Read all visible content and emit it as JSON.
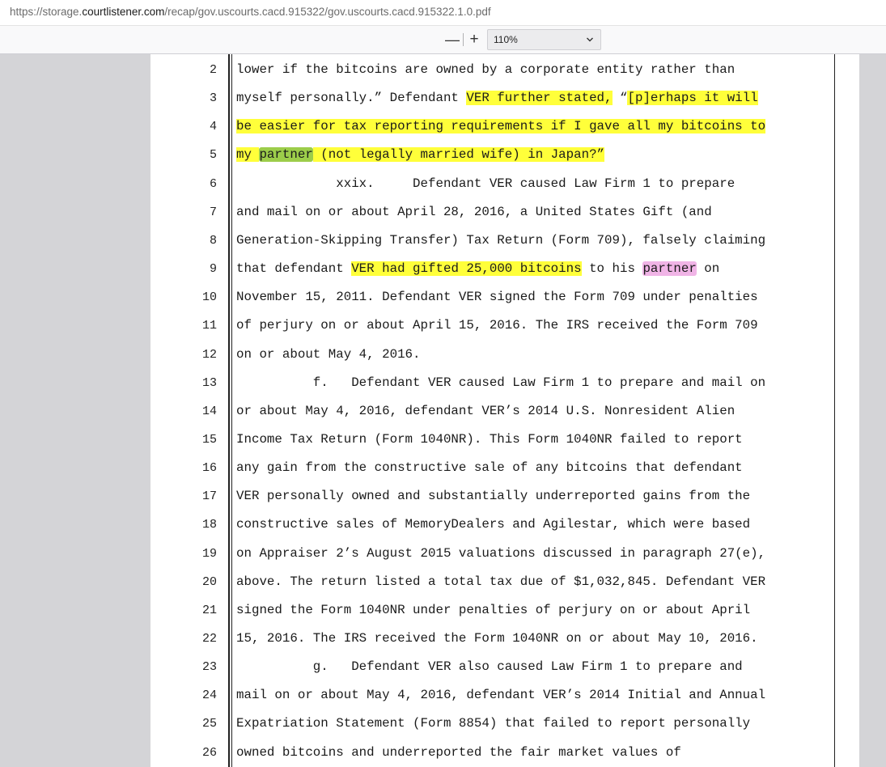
{
  "browser": {
    "url_prefix": "https://storage.",
    "url_domain": "courtlistener.com",
    "url_path": "/recap/gov.uscourts.cacd.915322/gov.uscourts.cacd.915322.1.0.pdf"
  },
  "toolbar": {
    "zoom_out_label": "—",
    "zoom_in_label": "+",
    "zoom_value": "110%"
  },
  "colors": {
    "highlight_yellow": "#ffff3a",
    "highlight_green": "#9ccd4a",
    "highlight_pink": "#f0b4e6"
  },
  "document": {
    "lines": [
      {
        "n": "2",
        "segments": [
          {
            "t": "lower if the bitcoins are owned by a corporate entity rather than"
          }
        ]
      },
      {
        "n": "3",
        "segments": [
          {
            "t": "myself personally.” Defendant "
          },
          {
            "t": "VER further stated,",
            "hl": "y"
          },
          {
            "t": " “"
          },
          {
            "t": "[p]erhaps it will",
            "hl": "y"
          }
        ]
      },
      {
        "n": "4",
        "segments": [
          {
            "t": "be easier for tax reporting requirements if I gave all my bitcoins to",
            "hl": "y"
          }
        ]
      },
      {
        "n": "5",
        "segments": [
          {
            "t": "my ",
            "hl": "y"
          },
          {
            "t": "partner",
            "hl": "g"
          },
          {
            "t": " (not legally married wife) in Japan?”",
            "hl": "y"
          }
        ]
      },
      {
        "n": "6",
        "segments": [
          {
            "t": "             xxix.     Defendant VER caused Law Firm 1 to prepare"
          }
        ]
      },
      {
        "n": "7",
        "segments": [
          {
            "t": "and mail on or about April 28, 2016, a United States Gift (and"
          }
        ]
      },
      {
        "n": "8",
        "segments": [
          {
            "t": "Generation-Skipping Transfer) Tax Return (Form 709), falsely claiming"
          }
        ]
      },
      {
        "n": "9",
        "segments": [
          {
            "t": "that defendant "
          },
          {
            "t": "VER had gifted 25,000 bitcoins",
            "hl": "y"
          },
          {
            "t": " to his "
          },
          {
            "t": "partner",
            "hl": "p"
          },
          {
            "t": " on"
          }
        ]
      },
      {
        "n": "10",
        "segments": [
          {
            "t": "November 15, 2011. Defendant VER signed the Form 709 under penalties"
          }
        ]
      },
      {
        "n": "11",
        "segments": [
          {
            "t": "of perjury on or about April 15, 2016. The IRS received the Form 709"
          }
        ]
      },
      {
        "n": "12",
        "segments": [
          {
            "t": "on or about May 4, 2016."
          }
        ]
      },
      {
        "n": "13",
        "segments": [
          {
            "t": "          f.   Defendant VER caused Law Firm 1 to prepare and mail on"
          }
        ]
      },
      {
        "n": "14",
        "segments": [
          {
            "t": "or about May 4, 2016, defendant VER’s 2014 U.S. Nonresident Alien"
          }
        ]
      },
      {
        "n": "15",
        "segments": [
          {
            "t": "Income Tax Return (Form 1040NR). This Form 1040NR failed to report"
          }
        ]
      },
      {
        "n": "16",
        "segments": [
          {
            "t": "any gain from the constructive sale of any bitcoins that defendant"
          }
        ]
      },
      {
        "n": "17",
        "segments": [
          {
            "t": "VER personally owned and substantially underreported gains from the"
          }
        ]
      },
      {
        "n": "18",
        "segments": [
          {
            "t": "constructive sales of MemoryDealers and Agilestar, which were based"
          }
        ]
      },
      {
        "n": "19",
        "segments": [
          {
            "t": "on Appraiser 2’s August 2015 valuations discussed in paragraph 27(e),"
          }
        ]
      },
      {
        "n": "20",
        "segments": [
          {
            "t": "above. The return listed a total tax due of $1,032,845. Defendant VER"
          }
        ]
      },
      {
        "n": "21",
        "segments": [
          {
            "t": "signed the Form 1040NR under penalties of perjury on or about April"
          }
        ]
      },
      {
        "n": "22",
        "segments": [
          {
            "t": "15, 2016. The IRS received the Form 1040NR on or about May 10, 2016."
          }
        ]
      },
      {
        "n": "23",
        "segments": [
          {
            "t": "          g.   Defendant VER also caused Law Firm 1 to prepare and"
          }
        ]
      },
      {
        "n": "24",
        "segments": [
          {
            "t": "mail on or about May 4, 2016, defendant VER’s 2014 Initial and Annual"
          }
        ]
      },
      {
        "n": "25",
        "segments": [
          {
            "t": "Expatriation Statement (Form 8854) that failed to report personally"
          }
        ]
      },
      {
        "n": "26",
        "segments": [
          {
            "t": "owned bitcoins and underreported the fair market values of"
          }
        ]
      }
    ]
  }
}
